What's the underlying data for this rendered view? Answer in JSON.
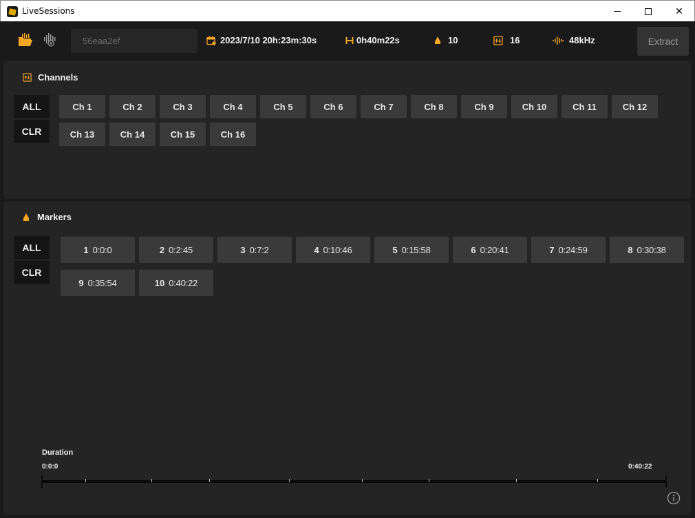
{
  "window": {
    "title": "LiveSessions",
    "controls": {
      "minimize_icon": "minimize-icon",
      "maximize_icon": "maximize-icon",
      "close_glyph": "✕"
    }
  },
  "toolbar": {
    "session_id": "56eaa2ef",
    "date": "2023/7/10 20h:23m:30s",
    "duration": "0h40m22s",
    "marker_count": "10",
    "channel_count": "16",
    "sample_rate": "48kHz",
    "extract_label": "Extract",
    "accent_color": "#f5a623"
  },
  "channels": {
    "title": "Channels",
    "all_label": "ALL",
    "clear_label": "CLR",
    "items": [
      "Ch 1",
      "Ch 2",
      "Ch 3",
      "Ch 4",
      "Ch 5",
      "Ch 6",
      "Ch 7",
      "Ch 8",
      "Ch 9",
      "Ch 10",
      "Ch 11",
      "Ch 12",
      "Ch 13",
      "Ch 14",
      "Ch 15",
      "Ch 16"
    ]
  },
  "markers": {
    "title": "Markers",
    "all_label": "ALL",
    "clear_label": "CLR",
    "items": [
      {
        "num": "1",
        "time": "0:0:0"
      },
      {
        "num": "2",
        "time": "0:2:45"
      },
      {
        "num": "3",
        "time": "0:7:2"
      },
      {
        "num": "4",
        "time": "0:10:46"
      },
      {
        "num": "5",
        "time": "0:15:58"
      },
      {
        "num": "6",
        "time": "0:20:41"
      },
      {
        "num": "7",
        "time": "0:24:59"
      },
      {
        "num": "8",
        "time": "0:30:38"
      },
      {
        "num": "9",
        "time": "0:35:54"
      },
      {
        "num": "10",
        "time": "0:40:22"
      }
    ]
  },
  "timeline": {
    "label": "Duration",
    "start": "0:0:0",
    "end": "0:40:22",
    "total_seconds": 2422,
    "marker_seconds": [
      165,
      422,
      646,
      958,
      1241,
      1499,
      1838,
      2154
    ]
  }
}
